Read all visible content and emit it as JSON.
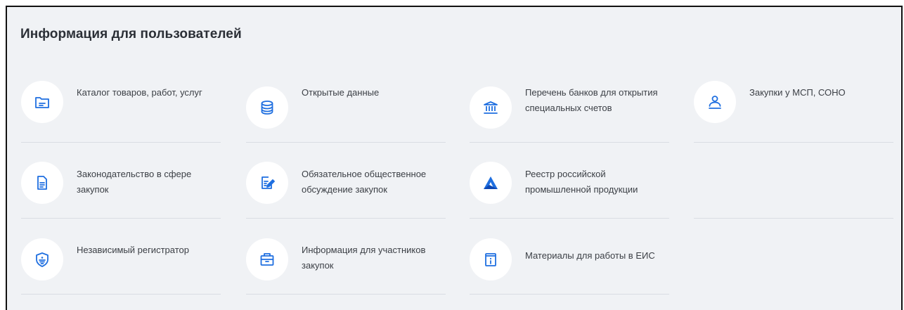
{
  "section": {
    "title": "Информация для пользователей"
  },
  "tiles": [
    {
      "label": "Каталог товаров, работ, услуг",
      "icon": "folder-icon"
    },
    {
      "label": "Открытые данные",
      "icon": "database-icon"
    },
    {
      "label": "Перечень банков для открытия специальных счетов",
      "icon": "bank-icon"
    },
    {
      "label": "Закупки у МСП, СОНО",
      "icon": "user-icon"
    },
    {
      "label": "Законодательство в сфере закупок",
      "icon": "document-icon"
    },
    {
      "label": "Обязательное общественное обсуждение закупок",
      "icon": "edit-document-icon"
    },
    {
      "label": "Реестр российской промышленной продукции",
      "icon": "triangle-logo-icon"
    },
    {
      "label": "Независимый регистратор",
      "icon": "shield-icon"
    },
    {
      "label": "Информация для участников закупок",
      "icon": "briefcase-icon"
    },
    {
      "label": "Материалы для работы в ЕИС",
      "icon": "info-book-icon"
    }
  ],
  "colors": {
    "accent": "#1f6fe0",
    "background": "#f0f2f5",
    "text": "#3b3f45"
  }
}
